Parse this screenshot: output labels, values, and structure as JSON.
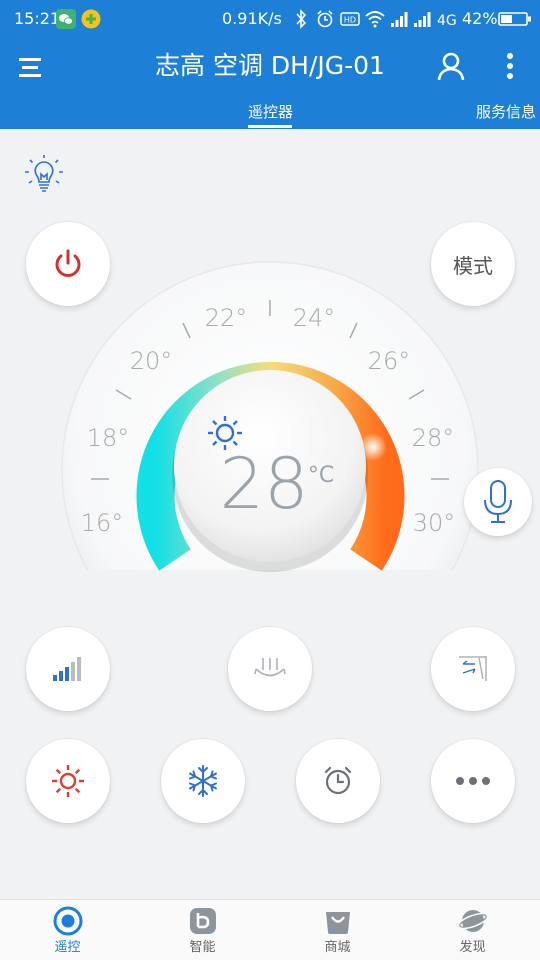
{
  "status_bar": {
    "time": "15:21",
    "speed": "0.91K/s",
    "network": "4G",
    "battery": "42%"
  },
  "header": {
    "title": "志高 空调 DH/JG-01",
    "tabs": [
      {
        "label": "遥控器",
        "active": true
      },
      {
        "label": "服务信息",
        "active": false
      }
    ]
  },
  "controls": {
    "mode_label": "模式"
  },
  "dial": {
    "temperature": "28",
    "unit": "°C",
    "ticks": [
      "16°",
      "18°",
      "20°",
      "22°",
      "24°",
      "26°",
      "28°",
      "30°"
    ]
  },
  "bottom_nav": [
    {
      "label": "遥控",
      "icon": "remote-icon",
      "active": true
    },
    {
      "label": "智能",
      "icon": "smart-icon",
      "active": false
    },
    {
      "label": "商城",
      "icon": "shop-icon",
      "active": false
    },
    {
      "label": "发现",
      "icon": "discover-icon",
      "active": false
    }
  ],
  "colors": {
    "accent": "#1e7fd6",
    "power": "#d32f2f",
    "heat": "#e53935",
    "icon_blue": "#2f6fd6"
  }
}
